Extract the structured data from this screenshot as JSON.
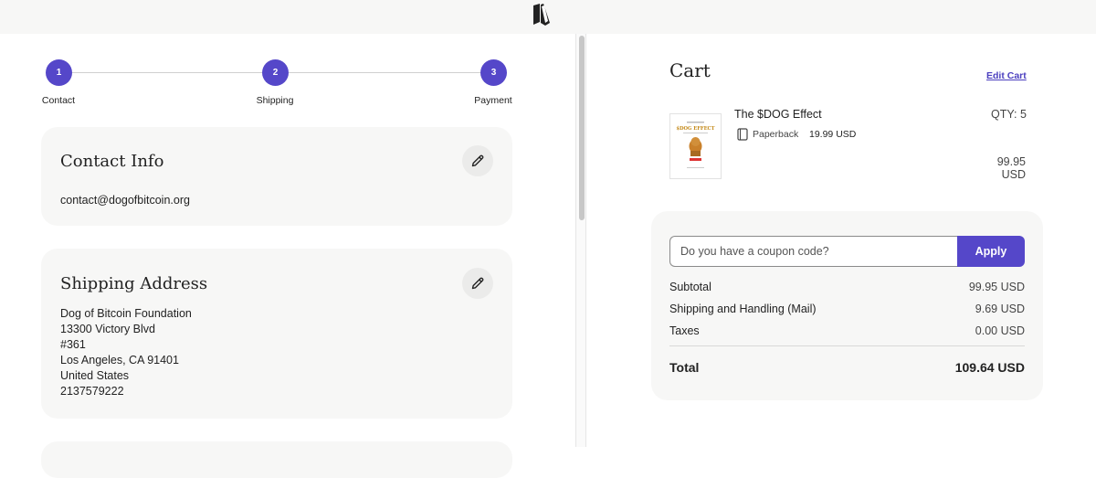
{
  "icons": {
    "logo": "book-logo-icon",
    "edit": "pencil-icon",
    "format": "book-icon"
  },
  "colors": {
    "accent": "#5547c9",
    "card_bg": "#f7f7f6",
    "link": "#4b3fbf"
  },
  "stepper": {
    "steps": [
      {
        "number": "1",
        "label": "Contact"
      },
      {
        "number": "2",
        "label": "Shipping"
      },
      {
        "number": "3",
        "label": "Payment"
      }
    ]
  },
  "contact": {
    "title": "Contact Info",
    "email": "contact@dogofbitcoin.org"
  },
  "shipping": {
    "title": "Shipping Address",
    "lines": [
      "Dog of Bitcoin Foundation",
      "13300 Victory Blvd",
      "#361",
      "Los Angeles, CA 91401",
      "United States",
      "2137579222"
    ]
  },
  "cart": {
    "title": "Cart",
    "edit_label": "Edit Cart",
    "item": {
      "title": "The $DOG Effect",
      "qty": "QTY: 5",
      "format": "Paperback",
      "unit_price": "19.99 USD",
      "line_total": "99.95 USD",
      "cover_text": "$DOG EFFECT"
    },
    "coupon": {
      "placeholder": "Do you have a coupon code?",
      "apply_label": "Apply"
    },
    "summary": [
      {
        "label": "Subtotal",
        "value": "99.95 USD"
      },
      {
        "label": "Shipping and Handling (Mail)",
        "value": "9.69 USD"
      },
      {
        "label": "Taxes",
        "value": "0.00 USD"
      }
    ],
    "total": {
      "label": "Total",
      "value": "109.64 USD"
    }
  }
}
